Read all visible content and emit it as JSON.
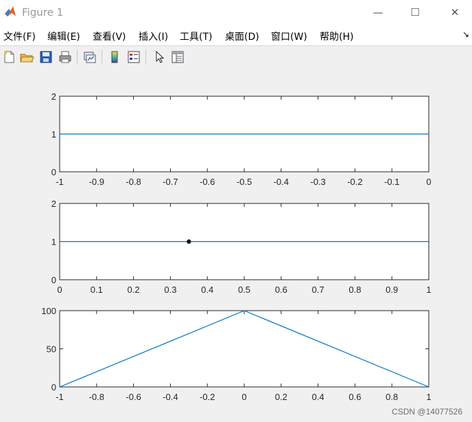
{
  "window": {
    "title": "Figure 1",
    "controls": {
      "minimize": "—",
      "maximize": "☐",
      "close": "✕"
    }
  },
  "menu": [
    "文件(F)",
    "编辑(E)",
    "查看(V)",
    "插入(I)",
    "工具(T)",
    "桌面(D)",
    "窗口(W)",
    "帮助(H)"
  ],
  "menu_overflow": "↘",
  "toolbar": [
    "new-figure-icon",
    "open-file-icon",
    "save-icon",
    "print-icon",
    "link-plot-icon",
    "colorbar-icon",
    "legend-icon",
    "pointer-icon",
    "property-inspector-icon"
  ],
  "colors": {
    "line": "#0072bd",
    "marker": "#1a1a1a",
    "axes": "#262626",
    "background": "#f0f0f0"
  },
  "chart_data": [
    {
      "type": "line",
      "x": [
        -1,
        0
      ],
      "y": [
        1,
        1
      ],
      "xlim": [
        -1,
        0
      ],
      "ylim": [
        0,
        2
      ],
      "xticks": [
        "-1",
        "-0.9",
        "-0.8",
        "-0.7",
        "-0.6",
        "-0.5",
        "-0.4",
        "-0.3",
        "-0.2",
        "-0.1",
        "0"
      ],
      "yticks": [
        "0",
        "1",
        "2"
      ],
      "grid": false
    },
    {
      "type": "line",
      "x": [
        0,
        1
      ],
      "y": [
        1,
        1
      ],
      "marker_point": {
        "x": 0.35,
        "y": 1
      },
      "xlim": [
        0,
        1
      ],
      "ylim": [
        0,
        2
      ],
      "xticks": [
        "0",
        "0.1",
        "0.2",
        "0.3",
        "0.4",
        "0.5",
        "0.6",
        "0.7",
        "0.8",
        "0.9",
        "1"
      ],
      "yticks": [
        "0",
        "1",
        "2"
      ],
      "grid": false
    },
    {
      "type": "line",
      "x": [
        -1,
        0,
        1
      ],
      "y": [
        0,
        100,
        0
      ],
      "xlim": [
        -1,
        1
      ],
      "ylim": [
        0,
        100
      ],
      "xticks": [
        "-1",
        "-0.8",
        "-0.6",
        "-0.4",
        "-0.2",
        "0",
        "0.2",
        "0.4",
        "0.6",
        "0.8",
        "1"
      ],
      "yticks": [
        "0",
        "50",
        "100"
      ],
      "grid": false
    }
  ],
  "watermark": "CSDN @14077526"
}
